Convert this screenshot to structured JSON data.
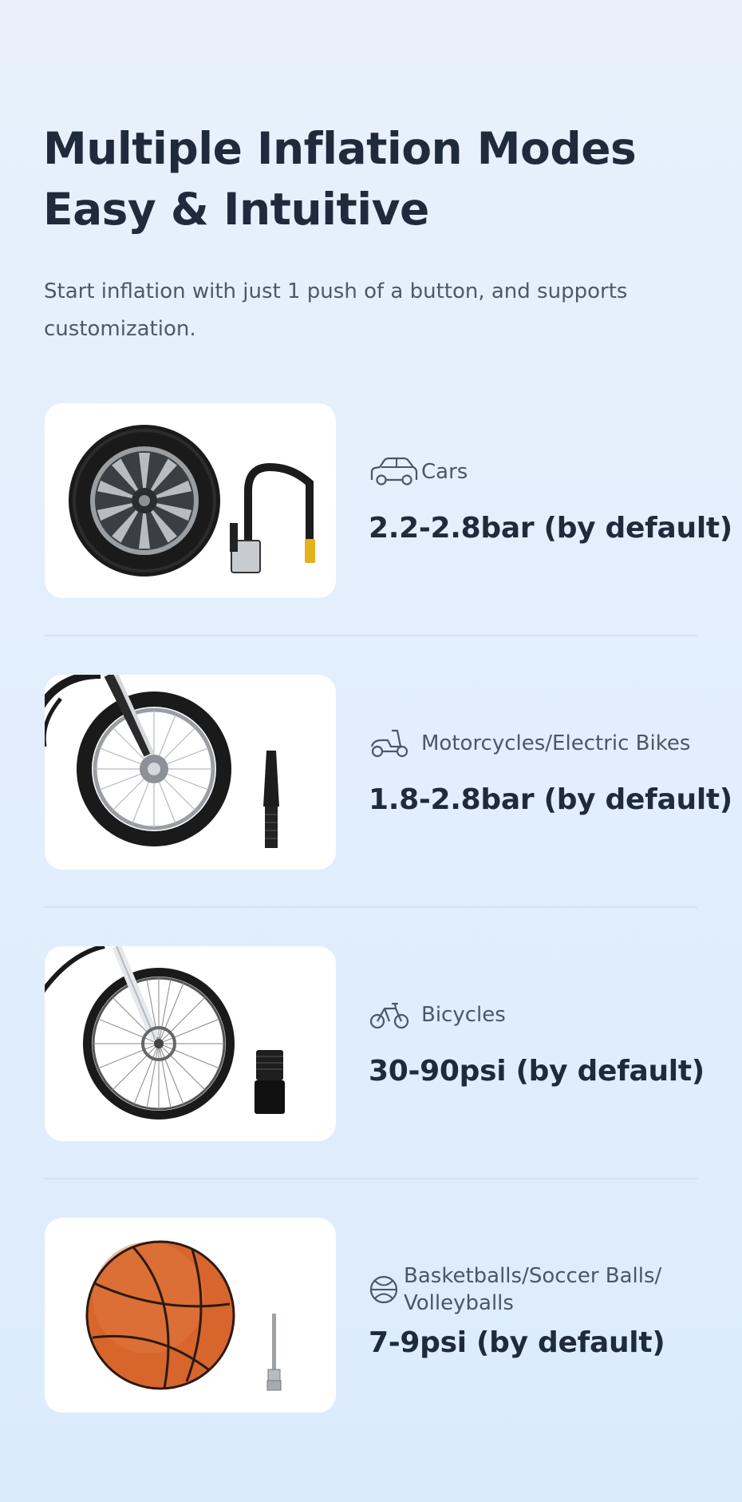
{
  "heading": {
    "line1": "Multiple Inflation Modes",
    "line2": "Easy & Intuitive"
  },
  "description": "Start inflation with just 1 push of a button, and supports customization.",
  "modes": [
    {
      "icon": "car-icon",
      "label": "Cars",
      "value": "2.2-2.8bar (by default)"
    },
    {
      "icon": "scooter-icon",
      "label": "Motorcycles/Electric Bikes",
      "value": "1.8-2.8bar (by default)"
    },
    {
      "icon": "bicycle-icon",
      "label": "Bicycles",
      "value": "30-90psi (by default)"
    },
    {
      "icon": "basketball-icon",
      "label": "Basketballs/Soccer Balls/ Volleyballs",
      "value": "7-9psi (by default)"
    }
  ],
  "colors": {
    "heading": "#1f2b3d",
    "body_text": "#4e5968",
    "card_background": "#ffffff",
    "page_background": "#e3effd"
  }
}
